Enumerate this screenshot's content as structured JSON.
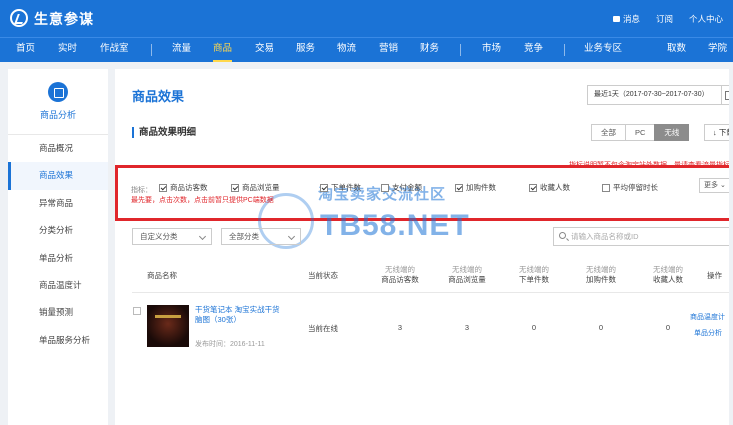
{
  "app": {
    "title": "生意参谋"
  },
  "top_right": {
    "messages": "消息",
    "subscribe": "订阅",
    "personal": "个人中心"
  },
  "nav": [
    "首页",
    "实时",
    "作战室",
    "流量",
    "商品",
    "交易",
    "服务",
    "物流",
    "营销",
    "财务",
    "市场",
    "竞争",
    "业务专区",
    "取数",
    "学院"
  ],
  "sidebar": {
    "header": "商品分析",
    "items": [
      "商品概况",
      "商品效果",
      "异常商品",
      "分类分析",
      "单品分析",
      "商品温度计",
      "销量预测",
      "单品服务分析"
    ]
  },
  "main": {
    "title": "商品效果",
    "date_range": "最近1天（2017-07-30~2017-07-30）",
    "subtitle": "商品效果明细",
    "terminal_tabs": [
      "全部",
      "PC",
      "无线"
    ],
    "download": "下载",
    "top_hint": "指标说明暂不包含淘宝站外数据，量请查看流量指标",
    "metric_label": "指标：",
    "metrics": [
      {
        "label": "商品访客数",
        "checked": true
      },
      {
        "label": "商品浏览量",
        "checked": true
      },
      {
        "label": "下单件数",
        "checked": true
      },
      {
        "label": "支付金额",
        "checked": false
      },
      {
        "label": "加购件数",
        "checked": true
      },
      {
        "label": "收藏人数",
        "checked": true
      },
      {
        "label": "平均停留时长",
        "checked": false
      }
    ],
    "more": "更多",
    "hint": "最先要，点击次数，点击前暂只提供PC端数据",
    "watermark": {
      "cn": "淘宝卖家交流社区",
      "en": "TB58.NET"
    },
    "filters": {
      "custom_category": "自定义分类",
      "all_category": "全部分类"
    },
    "search_placeholder": "请输入商品名称或ID",
    "columns": {
      "name": "商品名称",
      "status": "当前状态",
      "visitors": {
        "prefix": "无线端的",
        "label": "商品访客数"
      },
      "pageviews": {
        "prefix": "无线端的",
        "label": "商品浏览量"
      },
      "orders": {
        "prefix": "无线端的",
        "label": "下单件数"
      },
      "carts": {
        "prefix": "无线端的",
        "label": "加购件数"
      },
      "favorites": {
        "prefix": "无线端的",
        "label": "收藏人数"
      },
      "action": "操作"
    },
    "rows": [
      {
        "name": "干货笔记本 淘宝实战干货脑图（30张）",
        "published": "发布时间：2016-11-11",
        "status": "当前在线",
        "visitors": "3",
        "pageviews": "3",
        "orders": "0",
        "carts": "0",
        "favorites": "0",
        "actions": [
          "商品温度计",
          "单品分析"
        ]
      }
    ]
  },
  "colors": {
    "brand": "#1b73d6",
    "highlight": "#e0262b",
    "active_nav": "#ffd84d"
  }
}
